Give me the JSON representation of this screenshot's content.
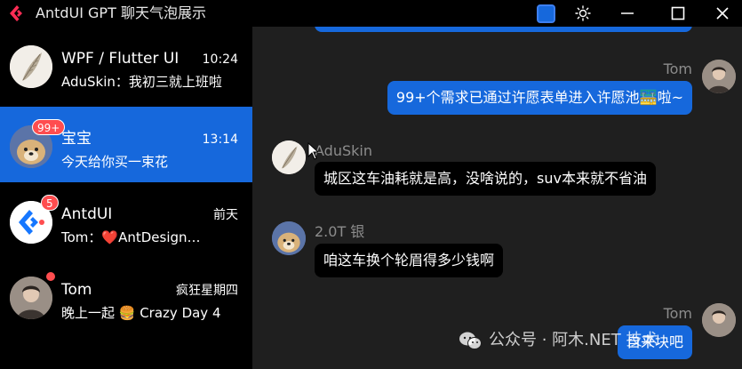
{
  "window": {
    "title": "AntdUI GPT 聊天气泡展示",
    "accent_color": "#1668dc",
    "icons": [
      "app-logo-icon",
      "sun-icon",
      "minimize-icon",
      "maximize-icon",
      "close-icon"
    ]
  },
  "conversations": [
    {
      "name": "WPF / Flutter UI",
      "time": "10:24",
      "preview": "AduSkin：我初三就上班啦",
      "badge": "",
      "active": false
    },
    {
      "name": "宝宝",
      "time": "13:14",
      "preview": "今天给你买一束花",
      "badge": "99+",
      "active": true
    },
    {
      "name": "AntdUI",
      "time": "前天",
      "preview": "Tom：❤️AntDesign…",
      "badge": "5",
      "active": false
    },
    {
      "name": "Tom",
      "time": "疯狂星期四",
      "preview": "晚上一起 🍔 Crazy Day 4",
      "badge": "",
      "dot": true,
      "active": false
    }
  ],
  "messages": [
    {
      "sender": "Tom",
      "text": "99+个需求已通过许愿表单进入许愿池🚟啦~",
      "mine": true
    },
    {
      "sender": "AduSkin",
      "text": "城区这车油耗就是高，没啥说的，suv本来就不省油",
      "mine": false
    },
    {
      "sender": "2.0T 银",
      "text": "咱这车换个轮眉得多少钱啊",
      "mine": false
    },
    {
      "sender": "Tom",
      "text": "自来块吧",
      "mine": true
    }
  ],
  "watermark": "公众号 · 阿木.NET 技术"
}
